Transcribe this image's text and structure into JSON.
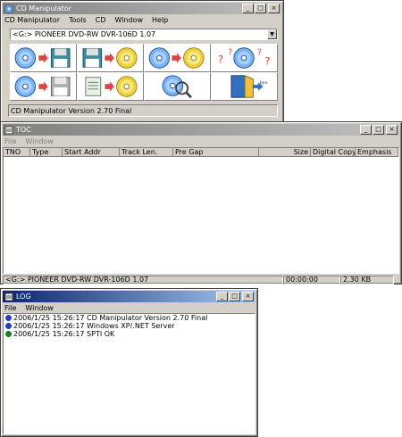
{
  "cdm": {
    "title": "CD Manipulator",
    "menu": [
      "CD Manipulator",
      "Tools",
      "CD",
      "Window",
      "Help"
    ],
    "drive": "<G:> PIONEER DVD-RW  DVR-106D 1.07",
    "status": "CD Manipulator Version 2.70 Final",
    "tools": [
      {
        "name": "read-cd-to-image",
        "icon": "disc-to-floppy-icon"
      },
      {
        "name": "write-image-to-cd",
        "icon": "floppy-to-disc-icon"
      },
      {
        "name": "copy-cd-to-cd",
        "icon": "disc-to-disc-icon"
      },
      {
        "name": "disc-info",
        "icon": "disc-question-icon"
      },
      {
        "name": "read-track",
        "icon": "disc-to-floppy-icon"
      },
      {
        "name": "write-from-file",
        "icon": "file-to-disc-icon"
      },
      {
        "name": "analyze-disc",
        "icon": "disc-magnifier-icon"
      },
      {
        "name": "exit",
        "icon": "door-exit-icon"
      }
    ]
  },
  "toc": {
    "title": "TOC",
    "menu": [
      "File",
      "Window"
    ],
    "columns": [
      "TNO",
      "Type",
      "Start Addr",
      "Track Len.",
      "Pre Gap",
      "Size",
      "Digital Copy",
      "Emphasis"
    ],
    "status_drive": "<G:> PIONEER DVD-RW  DVR-106D 1.07",
    "status_time": "00:00:00",
    "status_size": "2.30 KB"
  },
  "log": {
    "title": "LOG",
    "menu": [
      "File",
      "Window"
    ],
    "lines": [
      {
        "text": "2006/1/25 15:26:17 CD Manipulator Version 2.70 Final",
        "color": "#2040c0"
      },
      {
        "text": "2006/1/25 15:26:17 Windows XP/.NET Server",
        "color": "#2040c0"
      },
      {
        "text": "2006/1/25 15:26:17 SPTI    OK",
        "color": "#208020"
      }
    ]
  },
  "colors": {
    "active_title": "#0a246a",
    "inactive_title": "#808080"
  }
}
